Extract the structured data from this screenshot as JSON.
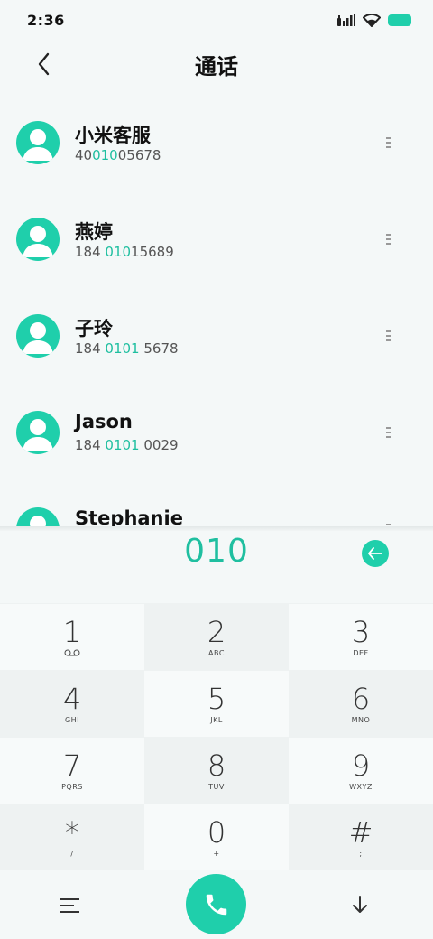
{
  "status_bar": {
    "time": "2:36"
  },
  "header": {
    "title": "通话"
  },
  "contacts": [
    {
      "name": "小米客服",
      "number_pre": "40",
      "number_match": "010",
      "number_post": "05678"
    },
    {
      "name": "燕婷",
      "number_pre": "184 ",
      "number_match": "010",
      "number_post": "15689"
    },
    {
      "name": "子玲",
      "number_pre": "184 ",
      "number_match": "0101",
      "number_post": " 5678"
    },
    {
      "name": "Jason",
      "number_pre": "184 ",
      "number_match": "0101",
      "number_post": " 0029"
    },
    {
      "name": "Stephanie",
      "number_pre": "",
      "number_match": "",
      "number_post": ""
    }
  ],
  "dialer": {
    "input": "010"
  },
  "keypad": [
    {
      "digit": "1",
      "sub": ""
    },
    {
      "digit": "2",
      "sub": "ABC"
    },
    {
      "digit": "3",
      "sub": "DEF"
    },
    {
      "digit": "4",
      "sub": "GHI"
    },
    {
      "digit": "5",
      "sub": "JKL"
    },
    {
      "digit": "6",
      "sub": "MNO"
    },
    {
      "digit": "7",
      "sub": "PQRS"
    },
    {
      "digit": "8",
      "sub": "TUV"
    },
    {
      "digit": "9",
      "sub": "WXYZ"
    },
    {
      "digit": "*",
      "sub": "/"
    },
    {
      "digit": "0",
      "sub": "+"
    },
    {
      "digit": "#",
      "sub": ";"
    }
  ],
  "colors": {
    "accent": "#1fcfab",
    "highlight_text": "#1fbfa0"
  },
  "icons": {
    "back": "chevron-left-icon",
    "more": "more-vertical-icon",
    "backspace": "backspace-icon",
    "voicemail": "voicemail-icon",
    "menu": "menu-icon",
    "call": "phone-icon",
    "collapse": "arrow-down-icon"
  }
}
